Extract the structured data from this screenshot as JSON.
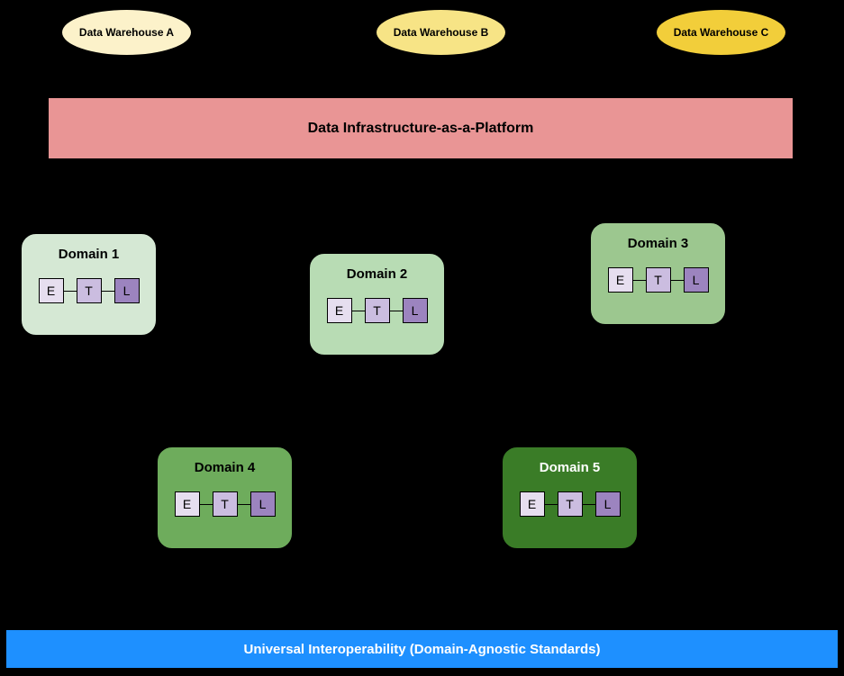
{
  "warehouses": {
    "a": "Data Warehouse A",
    "b": "Data Warehouse B",
    "c": "Data Warehouse C"
  },
  "platform": "Data Infrastructure-as-a-Platform",
  "domains": {
    "d1": "Domain 1",
    "d2": "Domain 2",
    "d3": "Domain 3",
    "d4": "Domain 4",
    "d5": "Domain 5"
  },
  "etl": {
    "e": "E",
    "t": "T",
    "l": "L"
  },
  "footer": "Universal Interoperability (Domain-Agnostic Standards)"
}
